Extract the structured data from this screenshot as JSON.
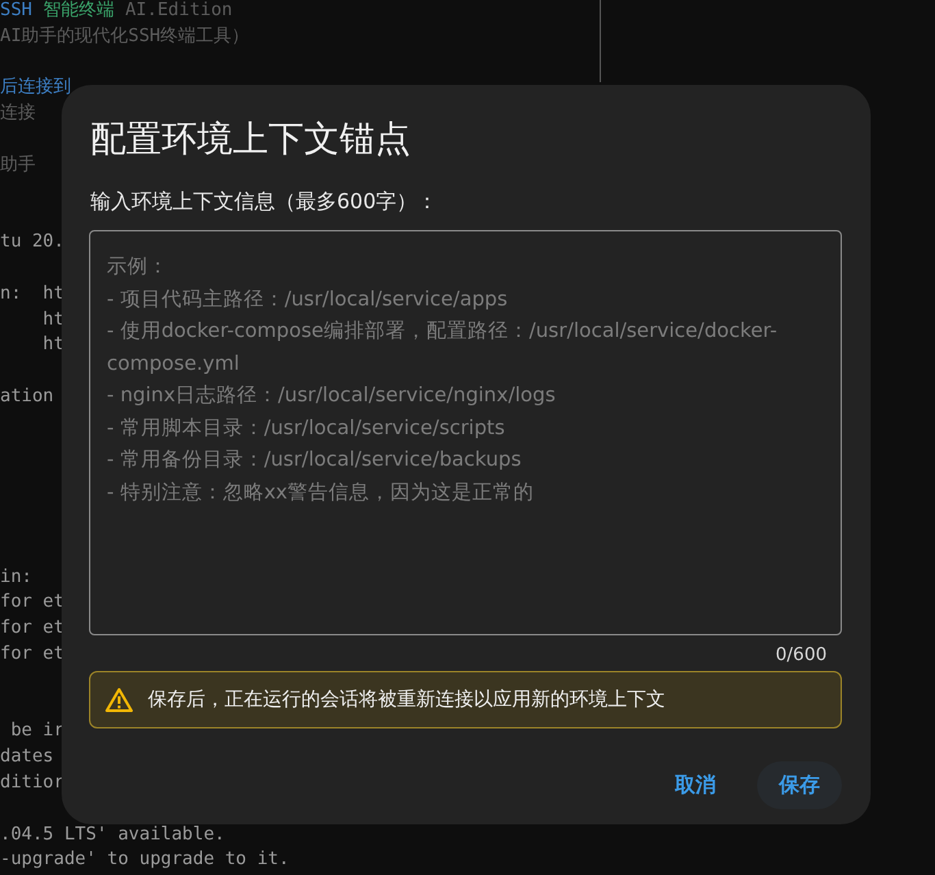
{
  "terminal": {
    "lines": [
      {
        "kind": "text",
        "segments": [
          {
            "text": "SSH",
            "kind": "accent"
          },
          {
            "text": "智能终端",
            "kind": "success"
          },
          {
            "text": "AI.Edition",
            "kind": "dim"
          }
        ]
      },
      {
        "kind": "text",
        "segments": [
          {
            "text": "AI助手的现代化SSH终端工具）",
            "kind": "dim"
          }
        ]
      },
      {
        "kind": "blank"
      },
      {
        "kind": "text",
        "segments": [
          {
            "text": "后连接到",
            "kind": "accent"
          }
        ]
      },
      {
        "kind": "text",
        "segments": [
          {
            "text": "连接",
            "kind": "dim"
          }
        ]
      },
      {
        "kind": "blank"
      },
      {
        "kind": "text",
        "segments": [
          {
            "text": "助手",
            "kind": "dim"
          }
        ]
      },
      {
        "kind": "blank"
      },
      {
        "kind": "blank"
      },
      {
        "kind": "text",
        "segments": [
          {
            "text": "tu 20.",
            "kind": "plain"
          }
        ]
      },
      {
        "kind": "blank"
      },
      {
        "kind": "text",
        "segments": [
          {
            "text": "n:  ht",
            "kind": "plain"
          }
        ]
      },
      {
        "kind": "text",
        "segments": [
          {
            "text": "    ht",
            "kind": "plain"
          }
        ]
      },
      {
        "kind": "text",
        "segments": [
          {
            "text": "    ht",
            "kind": "plain"
          }
        ]
      },
      {
        "kind": "blank"
      },
      {
        "kind": "text",
        "segments": [
          {
            "text": "ation",
            "kind": "plain"
          }
        ]
      },
      {
        "kind": "blank"
      },
      {
        "kind": "blank"
      },
      {
        "kind": "blank"
      },
      {
        "kind": "blank"
      },
      {
        "kind": "blank"
      },
      {
        "kind": "blank"
      },
      {
        "kind": "text",
        "segments": [
          {
            "text": "in:",
            "kind": "plain"
          }
        ]
      },
      {
        "kind": "text",
        "segments": [
          {
            "text": "for et",
            "kind": "plain"
          }
        ]
      },
      {
        "kind": "text",
        "segments": [
          {
            "text": "for et",
            "kind": "plain"
          }
        ]
      },
      {
        "kind": "text",
        "segments": [
          {
            "text": "for et",
            "kind": "plain"
          }
        ]
      },
      {
        "kind": "blank"
      },
      {
        "kind": "blank"
      },
      {
        "kind": "text",
        "segments": [
          {
            "text": " be ir",
            "kind": "plain"
          }
        ]
      },
      {
        "kind": "text",
        "segments": [
          {
            "text": "dates",
            "kind": "plain"
          }
        ]
      },
      {
        "kind": "text",
        "segments": [
          {
            "text": "ditior",
            "kind": "plain"
          }
        ]
      },
      {
        "kind": "blank"
      },
      {
        "kind": "text",
        "segments": [
          {
            "text": ".04.5 LTS' available.",
            "kind": "plain"
          }
        ]
      },
      {
        "kind": "text",
        "segments": [
          {
            "text": "-upgrade' to upgrade to it.",
            "kind": "plain"
          }
        ]
      }
    ]
  },
  "dialog": {
    "title": "配置环境上下文锚点",
    "label": "输入环境上下文信息（最多600字）：",
    "field": {
      "placeholder": "示例：\n- 项目代码主路径：/usr/local/service/apps\n- 使用docker-compose编排部署，配置路径：/usr/local/service/docker-compose.yml\n- nginx日志路径：/usr/local/service/nginx/logs\n- 常用脚本目录：/usr/local/service/scripts\n- 常用备份目录：/usr/local/service/backups\n- 特别注意：忽略xx警告信息，因为这是正常的",
      "counter": "0/600"
    },
    "warning": "保存后，正在运行的会话将被重新连接以应用新的环境上下文",
    "buttons": [
      {
        "label": "取消",
        "kind": "text"
      },
      {
        "label": "保存",
        "kind": "tonal"
      }
    ]
  }
}
